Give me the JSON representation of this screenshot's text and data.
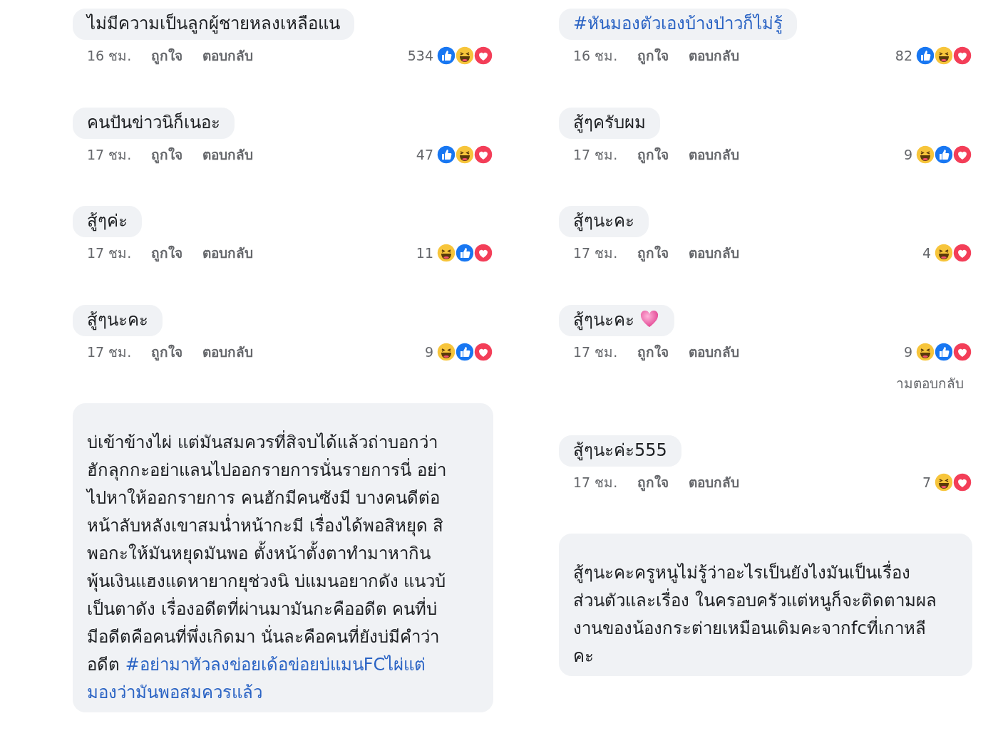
{
  "columns": [
    {
      "comments": [
        {
          "text": "ไม่มีความเป็นลูกผู้ชายหลงเหลือแน",
          "time": "16 ชม.",
          "like_label": "ถูกใจ",
          "reply_label": "ตอบกลับ",
          "count": "534",
          "reactions": [
            {
              "kind": "like"
            },
            {
              "kind": "haha"
            },
            {
              "kind": "love"
            }
          ]
        },
        {
          "text": "คนปันข่าวนิก็เนอะ",
          "time": "17 ชม.",
          "like_label": "ถูกใจ",
          "reply_label": "ตอบกลับ",
          "count": "47",
          "reactions": [
            {
              "kind": "like"
            },
            {
              "kind": "haha"
            },
            {
              "kind": "love"
            }
          ]
        },
        {
          "text": "สู้ๆค่ะ",
          "time": "17 ชม.",
          "like_label": "ถูกใจ",
          "reply_label": "ตอบกลับ",
          "count": "11",
          "reactions": [
            {
              "kind": "haha"
            },
            {
              "kind": "like"
            },
            {
              "kind": "love"
            }
          ]
        },
        {
          "text": "สู้ๆนะคะ",
          "time": "17 ชม.",
          "like_label": "ถูกใจ",
          "reply_label": "ตอบกลับ",
          "count": "9",
          "reactions": [
            {
              "kind": "haha"
            },
            {
              "kind": "like"
            },
            {
              "kind": "love"
            }
          ]
        },
        {
          "lines": [
            {
              "text": "บ่เข้าข้างไผ่ แต่มันสมควรที่สิจบได้แล้วถ่าบอกว่า"
            },
            {
              "text": "ฮักลุกกะอย่าแลนไปออกรายการนั่นรายการนี่ อย่า"
            },
            {
              "text": "ไปหาให้ออกรายการ คนฮักมีคนซังมี บางคนดีต่อ"
            },
            {
              "text": "หน้าลับหลังเขาสมน่ำหน้ากะมี เรื่องได้พอสิหยุด สิ"
            },
            {
              "text": "พอกะให้มันหยุดมันพอ ตั้งหน้าตั้งตาทำมาหากิน"
            },
            {
              "text": "พุ้นเงินแฮงแดหายากยุช่วงนิ บ่แมนอยากดัง แนวบ้"
            },
            {
              "text": "เป็นตาดัง เรื่องอดีตที่ผ่านมามันกะคืออดีต คนที่บ่"
            },
            {
              "text": "มีอดีตคือคนที่พึ่งเกิดมา นั่นละคือคนที่ยังบ่มีคำว่า"
            },
            {
              "text": "อดีต",
              "hashtag": "#อย่ามาทัวลงข่อยเด้อข่อยบ่แมนFCไผ่แต่"
            },
            {
              "hashtag": "มองว่ามันพอสมควรแล้ว"
            }
          ]
        }
      ]
    },
    {
      "comments": [
        {
          "hashtag": "#หันมองตัวเองบ้างป่าวก็ไม่รู้",
          "time": "16 ชม.",
          "like_label": "ถูกใจ",
          "reply_label": "ตอบกลับ",
          "count": "82",
          "reactions": [
            {
              "kind": "like"
            },
            {
              "kind": "haha"
            },
            {
              "kind": "love"
            }
          ]
        },
        {
          "text": "สู้ๆครับผม",
          "time": "17 ชม.",
          "like_label": "ถูกใจ",
          "reply_label": "ตอบกลับ",
          "count": "9",
          "reactions": [
            {
              "kind": "haha"
            },
            {
              "kind": "like"
            },
            {
              "kind": "love"
            }
          ]
        },
        {
          "text": "สู้ๆนะคะ",
          "time": "17 ชม.",
          "like_label": "ถูกใจ",
          "reply_label": "ตอบกลับ",
          "count": "4",
          "reactions": [
            {
              "kind": "haha"
            },
            {
              "kind": "love"
            }
          ]
        },
        {
          "text": "สู้ๆนะคะ",
          "heart_emoji": true,
          "time": "17 ชม.",
          "like_label": "ถูกใจ",
          "reply_label": "ตอบกลับ",
          "count": "9",
          "reactions": [
            {
              "kind": "haha"
            },
            {
              "kind": "like"
            },
            {
              "kind": "love"
            }
          ],
          "replies_link": "ามตอบกลับ"
        },
        {
          "text": "สู้ๆนะค่ะ555",
          "time": "17 ชม.",
          "like_label": "ถูกใจ",
          "reply_label": "ตอบกลับ",
          "count": "7",
          "reactions": [
            {
              "kind": "haha"
            },
            {
              "kind": "love"
            }
          ]
        },
        {
          "lines": [
            {
              "text": "สู้ๆนะคะครูหนูไม่รู้ว่าอะไรเป็นยังไงมันเป็นเรื่อง"
            },
            {
              "text": "ส่วนตัวและเรื่อง ในครอบครัวแต่หนูก็จะติดตามผล"
            },
            {
              "text": "งานของน้องกระต่ายเหมือนเดิมคะจากfcที่เกาหลี"
            },
            {
              "text": "คะ"
            }
          ]
        }
      ]
    }
  ]
}
